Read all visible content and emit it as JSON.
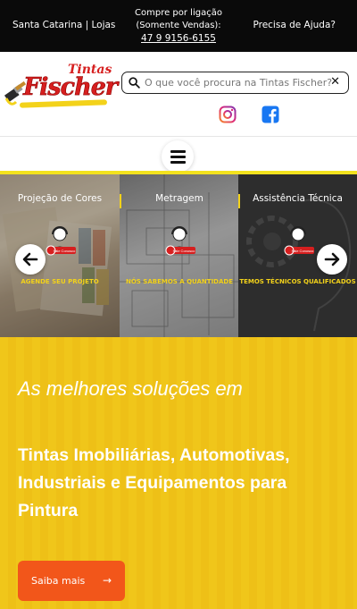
{
  "topbar": {
    "stores_label": "Santa Catarina | Lojas",
    "phone_line1": "Compre por ligação",
    "phone_line2": "(Somente Vendas):",
    "phone_number": "47 9 9156-6155",
    "help_label": "Precisa de Ajuda?"
  },
  "header": {
    "logo": {
      "top_word": "Tintas",
      "main_word": "Fischer"
    },
    "search": {
      "placeholder": "O que você procura na Tintas Fischer?",
      "value": "",
      "clear_icon": "close-icon"
    },
    "social": [
      {
        "name": "instagram",
        "icon": "instagram-icon",
        "color": "#e1306c"
      },
      {
        "name": "facebook",
        "icon": "facebook-icon",
        "color": "#1877f2"
      }
    ]
  },
  "nav": {
    "menu_icon": "hamburger-icon",
    "accent": "#f3e21e"
  },
  "slider": {
    "panels": [
      {
        "title": "Projeção de Cores",
        "badge": "Fale Conosco",
        "cta": "AGENDE SEU PROJETO"
      },
      {
        "title": "Metragem",
        "badge": "Fale Conosco",
        "cta": "NÓS SABEMOS A QUANTIDADE"
      },
      {
        "title": "Assistência Técnica",
        "badge": "Fale Conosco",
        "cta": "TEMOS TÉCNICOS QUALIFICADOS"
      }
    ],
    "prev_icon": "arrow-left-icon",
    "next_icon": "arrow-right-icon"
  },
  "hero": {
    "kicker": "As melhores soluções em",
    "headline": "Tintas Imobiliárias, Automotivas, Industriais e Equipamentos para Pintura",
    "button_label": "Saiba mais",
    "button_color": "#f2561a",
    "background": "#f0c61a"
  }
}
